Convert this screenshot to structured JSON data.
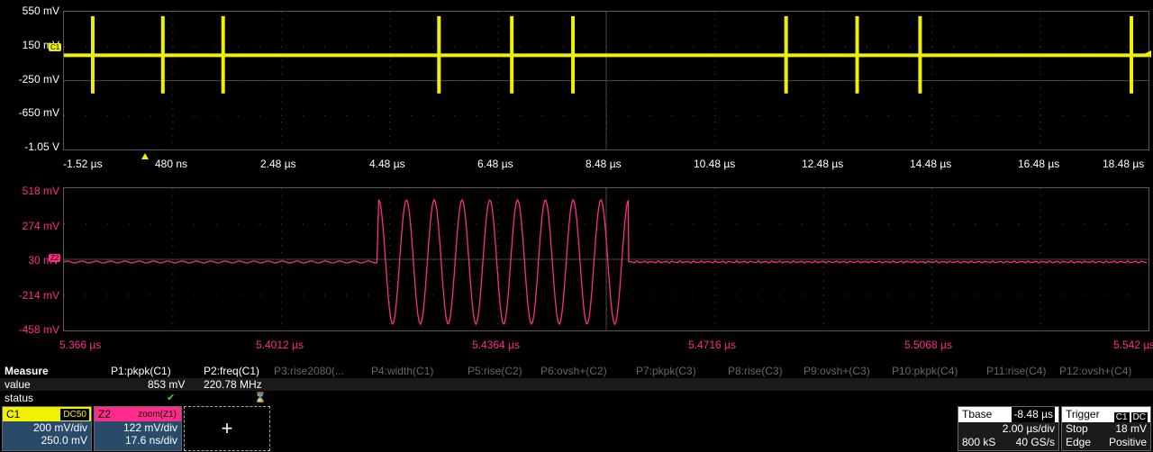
{
  "top_axis": {
    "y_labels": [
      "550 mV",
      "150 mV",
      "-250 mV",
      "-650 mV",
      "-1.05 V"
    ],
    "x_labels": [
      "-1.52 µs",
      "480 ns",
      "2.48 µs",
      "4.48 µs",
      "6.48 µs",
      "8.48 µs",
      "10.48 µs",
      "12.48 µs",
      "14.48 µs",
      "16.48 µs",
      "18.48 µs"
    ]
  },
  "bottom_axis": {
    "y_labels": [
      "518 mV",
      "274 mV",
      "30 mV",
      "-214 mV",
      "-458 mV"
    ],
    "x_labels": [
      "5.366 µs",
      "5.4012 µs",
      "5.4364 µs",
      "5.4716 µs",
      "5.5068 µs",
      "5.542 µs"
    ]
  },
  "markers": {
    "c1": "C1",
    "z2": "Z2"
  },
  "colors": {
    "c1": "#f0f000",
    "z2": "#ff2b8a",
    "grid": "#5a5a5a"
  },
  "measure": {
    "title": "Measure",
    "row_value_label": "value",
    "row_status_label": "status",
    "params": [
      {
        "head": "P1:pkpk(C1)",
        "value": "853 mV",
        "status": "✔",
        "active": true
      },
      {
        "head": "P2:freq(C1)",
        "value": "220.78 MHz",
        "status": "⌛",
        "active": true
      },
      {
        "head": "P3:rise2080(...",
        "value": "",
        "status": "",
        "active": false
      },
      {
        "head": "P4:width(C1)",
        "value": "",
        "status": "",
        "active": false
      },
      {
        "head": "P5:rise(C2)",
        "value": "",
        "status": "",
        "active": false
      },
      {
        "head": "P6:ovsh+(C2)",
        "value": "",
        "status": "",
        "active": false
      },
      {
        "head": "P7:pkpk(C3)",
        "value": "",
        "status": "",
        "active": false
      },
      {
        "head": "P8:rise(C3)",
        "value": "",
        "status": "",
        "active": false
      },
      {
        "head": "P9:ovsh+(C3)",
        "value": "",
        "status": "",
        "active": false
      },
      {
        "head": "P10:pkpk(C4)",
        "value": "",
        "status": "",
        "active": false
      },
      {
        "head": "P11:rise(C4)",
        "value": "",
        "status": "",
        "active": false
      },
      {
        "head": "P12:ovsh+(C4)",
        "value": "",
        "status": "",
        "active": false
      }
    ]
  },
  "c1_desc": {
    "name": "C1",
    "coupling": "DC50",
    "vdiv": "200 mV/div",
    "offset": "250.0 mV"
  },
  "z2_desc": {
    "name": "Z2",
    "source": "zoom(Z1)",
    "vdiv": "122 mV/div",
    "tdiv": "17.6 ns/div"
  },
  "add_trace": {
    "label": "+"
  },
  "tbase": {
    "label": "Tbase",
    "delay": "-8.48 µs",
    "tdiv": "2.00 µs/div",
    "samples": "800 kS",
    "rate": "40 GS/s"
  },
  "trigger": {
    "label": "Trigger",
    "src": "C1",
    "coupling": "DC",
    "mode": "Stop",
    "level": "18 mV",
    "type": "Edge",
    "slope": "Positive"
  }
}
